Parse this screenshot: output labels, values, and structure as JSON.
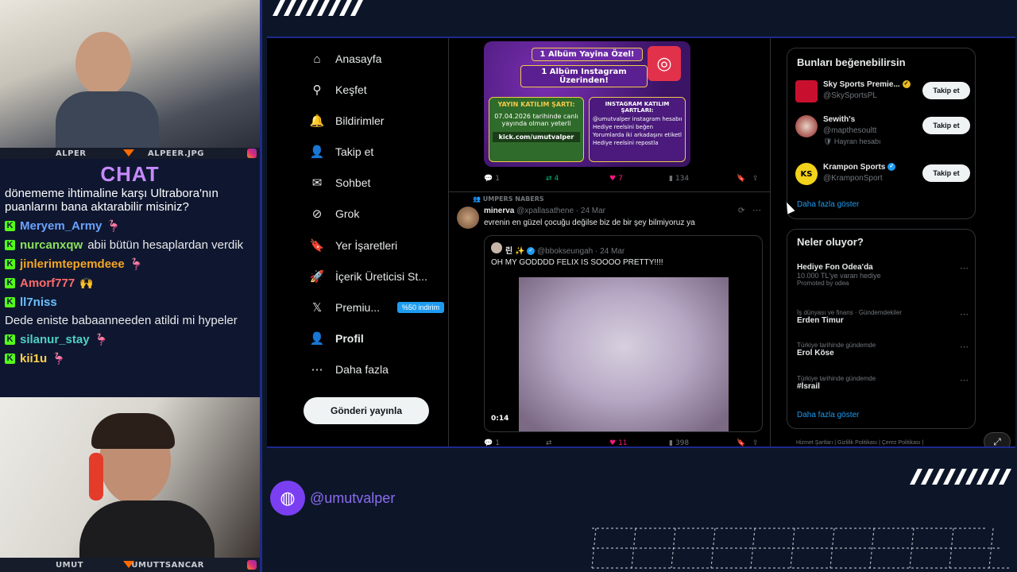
{
  "cams": {
    "top": {
      "left_name": "ALPER",
      "right_name": "ALPEER.JPG"
    },
    "bottom": {
      "left_name": "UMUT",
      "right_name": "UMUTTSANCAR"
    }
  },
  "chat": {
    "title": "CHAT",
    "first_message": "dönememe ihtimaline karşı Ultrabora'nın puanlarını bana aktarabilir misiniz?",
    "lines": [
      {
        "user": "Meryem_Army",
        "color": "#6aa2ff",
        "text": "",
        "emote": "🦩"
      },
      {
        "user": "nurcanxqw",
        "color": "#8be05a",
        "text": "abii bütün hesaplardan verdik",
        "emote": ""
      },
      {
        "user": "jinlerimtepemdeee",
        "color": "#f5a623",
        "text": "",
        "emote": "🦩"
      },
      {
        "user": "Amorf777",
        "color": "#ff6b6b",
        "text": "",
        "emote": "🙌"
      },
      {
        "user": "ll7niss",
        "color": "#69c0ff",
        "text": "Dede eniste babaanneeden atildi mi hypeler",
        "emote": ""
      },
      {
        "user": "silanur_stay",
        "color": "#4fd1c5",
        "text": "",
        "emote": "🦩"
      },
      {
        "user": "kii1u",
        "color": "#ffd34d",
        "text": "",
        "emote": "🦩"
      }
    ]
  },
  "nav": {
    "items": [
      {
        "label": "Anasayfa",
        "icon": "home-icon",
        "glyph": "⌂"
      },
      {
        "label": "Keşfet",
        "icon": "search-icon",
        "glyph": "⚲"
      },
      {
        "label": "Bildirimler",
        "icon": "bell-icon",
        "glyph": "🔔"
      },
      {
        "label": "Takip et",
        "icon": "follow-icon",
        "glyph": "👤"
      },
      {
        "label": "Sohbet",
        "icon": "mail-icon",
        "glyph": "✉"
      },
      {
        "label": "Grok",
        "icon": "grok-icon",
        "glyph": "⊘"
      },
      {
        "label": "Yer İşaretleri",
        "icon": "bookmark-icon",
        "glyph": "🔖"
      },
      {
        "label": "İçerik Üreticisi St...",
        "icon": "rocket-icon",
        "glyph": "🚀"
      },
      {
        "label": "Premiu...",
        "icon": "x-icon",
        "glyph": "𝕏"
      },
      {
        "label": "Profil",
        "icon": "profile-icon",
        "glyph": "👤"
      },
      {
        "label": "Daha fazla",
        "icon": "more-icon",
        "glyph": "⋯"
      }
    ],
    "premium_badge": "%50 indirim",
    "post_button": "Gönderi yayınla"
  },
  "promo": {
    "t1": "1 Albüm Yayina Özel!",
    "t2": "1 Albüm Instagram Üzerinden!",
    "left_head": "YAYIN KATILIM ŞARTI:",
    "left_body": "07.04.2026 tarihinde canlı yayında olman yeterli",
    "left_url": "kick.com/umutvalper",
    "right_head": "INSTAGRAM KATILIM ŞARTLARI:",
    "right_rows": [
      "@umutvalper instagram hesabını takip et",
      "Hediye reelsini beğen",
      "Yorumlarda iki arkadaşını etiketle",
      "Hediye reelsini repostla"
    ]
  },
  "tweet1_actions": {
    "replies": "1",
    "reposts": "4",
    "likes": "7",
    "views": "134"
  },
  "tweet2": {
    "context": "UMPERS NABERS",
    "name": "minerva",
    "handle": "@xpallasathene · 24 Mar",
    "text": "evrenin en güzel çocuğu değilse biz de bir şey bilmiyoruz ya",
    "quote_name": "린 ✨",
    "quote_handle": "@bbokseungah · 24 Mar",
    "quote_text": "OH MY GODDDD FELIX IS SOOOO PRETTY!!!!",
    "duration": "0:14",
    "actions": {
      "replies": "1",
      "reposts": "",
      "likes": "11",
      "views": "398"
    }
  },
  "suggest": {
    "title": "Bunları beğenebilirsin",
    "items": [
      {
        "name": "Sky Sports Premie...",
        "handle": "@SkySportsPL",
        "extra": "",
        "button": "Takip et"
      },
      {
        "name": "Sewith's",
        "handle": "@mapthesoultt",
        "extra": "🛡 Hayran hesabı",
        "button": "Takip et"
      },
      {
        "name": "Krampon Sports",
        "handle": "@KramponSport",
        "extra": "",
        "button": "Takip et"
      }
    ],
    "more": "Daha fazla göster"
  },
  "trends": {
    "title": "Neler oluyor?",
    "items": [
      {
        "context": "",
        "title": "Hediye Fon Odea'da",
        "sub": "10.000 TL'ye varan hediye",
        "promo": "Promoted by odea"
      },
      {
        "context": "İş dünyası ve finans · Gündemdekiler",
        "title": "Erden Timur",
        "sub": "",
        "promo": ""
      },
      {
        "context": "Türkiye tarihinde gündemde",
        "title": "Erol Köse",
        "sub": "",
        "promo": ""
      },
      {
        "context": "Türkiye tarihinde gündemde",
        "title": "#İsrail",
        "sub": "",
        "promo": ""
      }
    ],
    "more": "Daha fazla göster"
  },
  "footer": "Hizmet Şartları  |  Gizlilik Politikası  |  Çerez Politikası  |",
  "social_handle": "@umutvalper",
  "colors": {
    "accent": "#1d9bf0",
    "frame": "#1d2a8f",
    "chat_title": "#c58aff",
    "kick_green": "#53fc18"
  }
}
